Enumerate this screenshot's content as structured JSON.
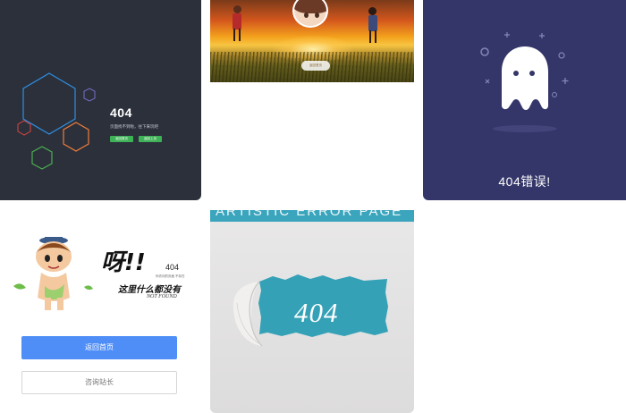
{
  "card1": {
    "code": "404",
    "description": "页面找不到啦，往下来玩吧",
    "button_home": "返回首页",
    "button_back": "返回上页"
  },
  "card2": {
    "button_label": "返回首页"
  },
  "card3": {
    "title": "404错误!"
  },
  "card4": {
    "exclaim": "呀!!",
    "code": "404",
    "small_text": "你访问的页面  不存在",
    "nothing_text": "这里什么都没有",
    "not_found": "NOT FOUND",
    "primary_button": "返回首页",
    "secondary_button": "咨询站长"
  },
  "card5": {
    "header_text": "ARTISTIC ERROR PAGE",
    "code": "404"
  },
  "colors": {
    "card1_bg": "#2b303b",
    "card1_green": "#3fb157",
    "card3_bg": "#343669",
    "card4_blue": "#4f8ef7",
    "card5_teal": "#3aa5bd"
  }
}
